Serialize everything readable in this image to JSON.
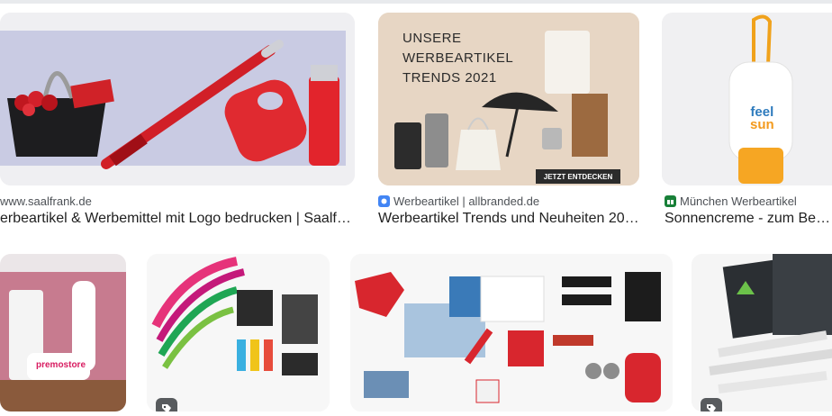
{
  "results_row1": [
    {
      "source": "www.saalfrank.de",
      "title": "erbeartikel & Werbemittel mit Logo bedrucken | Saalfr…",
      "favicon": "none"
    },
    {
      "source": "Werbeartikel | allbranded.de",
      "title": "Werbeartikel Trends und Neuheiten 20…",
      "favicon": "allbranded-icon",
      "banner_line1": "UNSERE",
      "banner_line2": "WERBEARTIKEL",
      "banner_line3": "TRENDS 2021",
      "cta": "JETZT ENTDECKEN"
    },
    {
      "source": "München Werbeartikel",
      "title": "Sonnencreme - zum Bedru",
      "favicon": "gift-icon",
      "bottle_line1": "feel",
      "bottle_line2": "sun"
    }
  ],
  "results_row2": [
    {
      "label": "premostore"
    },
    {
      "label": ""
    },
    {
      "label": ""
    },
    {
      "label": ""
    }
  ],
  "colors": {
    "accent_blue": "#4285f4",
    "gift_green": "#188038",
    "text": "#1f1f1f",
    "meta": "#4d5156"
  }
}
